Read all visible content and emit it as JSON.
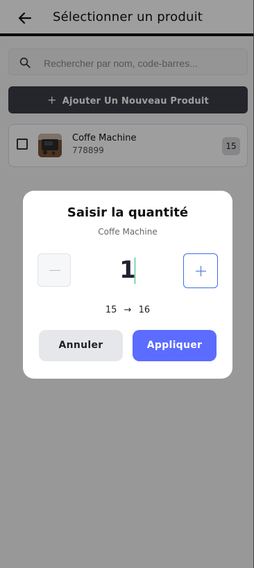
{
  "header": {
    "title": "Sélectionner un produit",
    "back_icon": "arrow-left-icon"
  },
  "search": {
    "placeholder": "Rechercher par nom, code-barres...",
    "icon": "search-icon"
  },
  "add_button": {
    "icon": "+",
    "label": "Ajouter Un Nouveau Produit"
  },
  "products": [
    {
      "name": "Coffe Machine",
      "code": "778899",
      "stock": "15",
      "checked": false
    }
  ],
  "modal": {
    "title": "Saisir la quantité",
    "subtitle": "Coffe Machine",
    "quantity": "1",
    "change_from": "15",
    "arrow": "→",
    "change_to": "16",
    "cancel_label": "Annuler",
    "apply_label": "Appliquer"
  },
  "colors": {
    "primary": "#5b6cff",
    "dark_button": "#3c3d47",
    "stepper_accent": "#3b6fe0"
  }
}
